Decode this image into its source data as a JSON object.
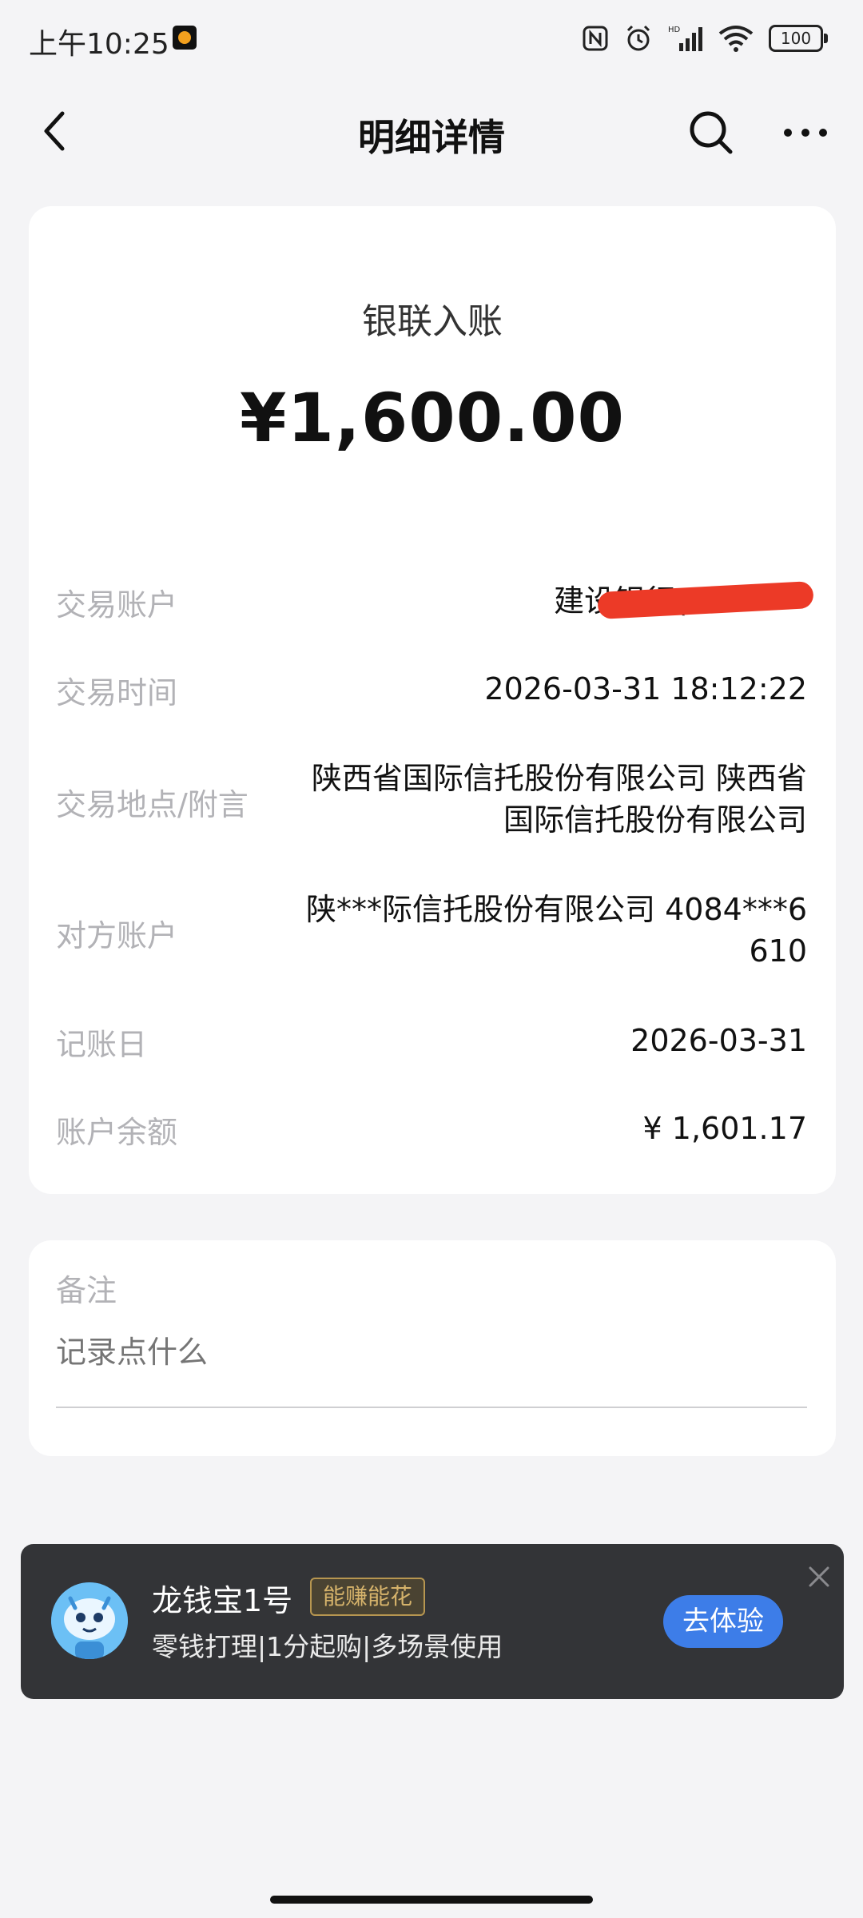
{
  "status_bar": {
    "time": "上午10:25",
    "battery": "100"
  },
  "header": {
    "title": "明细详情",
    "icons": [
      "back-arrow-icon",
      "search-icon",
      "more-icon"
    ]
  },
  "transaction": {
    "type": "银联入账",
    "amount": "¥1,600.00",
    "rows": [
      {
        "label": "交易账户",
        "value": "建设银行("
      },
      {
        "label": "交易时间",
        "value": "2026-03-31 18:12:22"
      },
      {
        "label": "交易地点/附言",
        "value_line1": "陕西省国际信托股份有限公司 陕西省",
        "value_line2": "国际信托股份有限公司"
      },
      {
        "label": "对方账户",
        "value_line1": "陕***际信托股份有限公司 4084***6",
        "value_line2": "610"
      },
      {
        "label": "记账日",
        "value": "2026-03-31"
      },
      {
        "label": "账户余额",
        "value": "¥ 1,601.17"
      }
    ]
  },
  "note": {
    "label": "备注",
    "placeholder": "记录点什么"
  },
  "promo": {
    "title": "龙钱宝1号",
    "tag": "能赚能花",
    "subtitle": "零钱打理|1分起购|多场景使用",
    "button": "去体验",
    "colors": {
      "background": "#333437",
      "button": "#3d7de8",
      "tag": "#d6b36b"
    }
  },
  "colors": {
    "page_bg": "#f4f4f6",
    "redaction": "#ec3a27"
  }
}
